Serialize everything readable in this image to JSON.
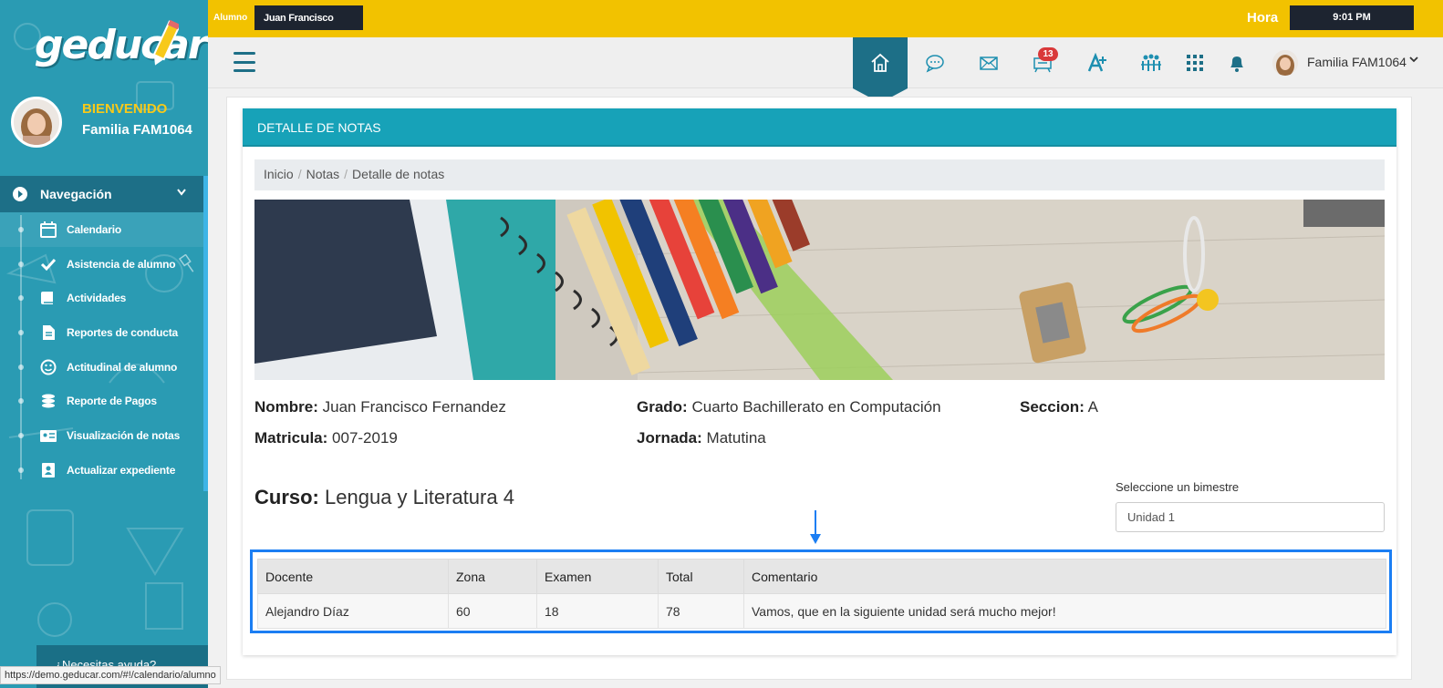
{
  "topbar": {
    "student_label": "Alumno",
    "student_name": "Juan Francisco",
    "time_label": "Hora",
    "time_value": "9:01 PM"
  },
  "sidebar": {
    "logo_text": "geducar",
    "welcome": "BIENVENIDO",
    "family": "Familia FAM1064",
    "nav_title": "Navegación",
    "items": [
      {
        "label": "Calendario",
        "icon": "calendar-icon"
      },
      {
        "label": "Asistencia de alumno",
        "icon": "check-icon"
      },
      {
        "label": "Actividades",
        "icon": "book-icon"
      },
      {
        "label": "Reportes de conducta",
        "icon": "document-icon"
      },
      {
        "label": "Actitudinal de alumno",
        "icon": "smile-icon"
      },
      {
        "label": "Reporte de Pagos",
        "icon": "coins-icon"
      },
      {
        "label": "Visualización de notas",
        "icon": "id-card-icon"
      },
      {
        "label": "Actualizar expediente",
        "icon": "address-book-icon"
      }
    ],
    "help_text": "¿Necesitas ayuda?",
    "status_url": "https://demo.geducar.com/#!/calendario/alumno"
  },
  "header": {
    "notification_count": "13",
    "user_name": "Familia FAM1064",
    "chevron": "⌄"
  },
  "panel": {
    "title": "DETALLE DE NOTAS",
    "breadcrumb": [
      "Inicio",
      "Notas",
      "Detalle de notas"
    ],
    "student": {
      "name_label": "Nombre:",
      "name_value": "Juan Francisco Fernandez",
      "grade_label": "Grado:",
      "grade_value": "Cuarto Bachillerato en Computación",
      "section_label": "Seccion:",
      "section_value": "A",
      "enrollment_label": "Matricula:",
      "enrollment_value": "007-2019",
      "shift_label": "Jornada:",
      "shift_value": "Matutina"
    },
    "course_label": "Curso:",
    "course_value": "Lengua y Literatura 4",
    "select_label": "Seleccione un bimestre",
    "select_value": "Unidad 1",
    "table": {
      "headers": [
        "Docente",
        "Zona",
        "Examen",
        "Total",
        "Comentario"
      ],
      "rows": [
        [
          "Alejandro Díaz",
          "60",
          "18",
          "78",
          "Vamos, que en la siguiente unidad será mucho mejor!"
        ]
      ]
    }
  },
  "colors": {
    "sidebar": "#2a9bb3",
    "topbar": "#f2c200",
    "panel_header": "#17a2b8",
    "highlight": "#1b7ef3"
  }
}
